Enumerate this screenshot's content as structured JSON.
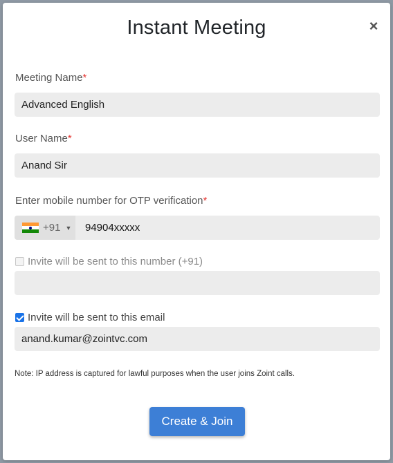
{
  "modal": {
    "title": "Instant Meeting",
    "close_symbol": "×"
  },
  "meeting_name": {
    "label": "Meeting Name",
    "required_mark": "*",
    "value": "Advanced English"
  },
  "user_name": {
    "label": "User Name",
    "required_mark": "*",
    "value": "Anand Sir"
  },
  "mobile": {
    "label": "Enter mobile number for OTP verification",
    "required_mark": "*",
    "country_flag": "india-flag-icon",
    "dial_code": "+91",
    "caret": "▼",
    "value": "94904xxxxx"
  },
  "invite_phone": {
    "checked": false,
    "label": "Invite will be sent to this number (+91)",
    "value": ""
  },
  "invite_email": {
    "checked": true,
    "label": "Invite will be sent to this email",
    "value": "anand.kumar@zointvc.com"
  },
  "note": "Note: IP address is captured for lawful purposes when the user joins Zoint calls.",
  "actions": {
    "create_join_label": "Create & Join"
  },
  "colors": {
    "primary": "#3d7fd6",
    "required": "#e53935",
    "field_bg": "#ececec",
    "checkbox_checked": "#1a73e8"
  }
}
